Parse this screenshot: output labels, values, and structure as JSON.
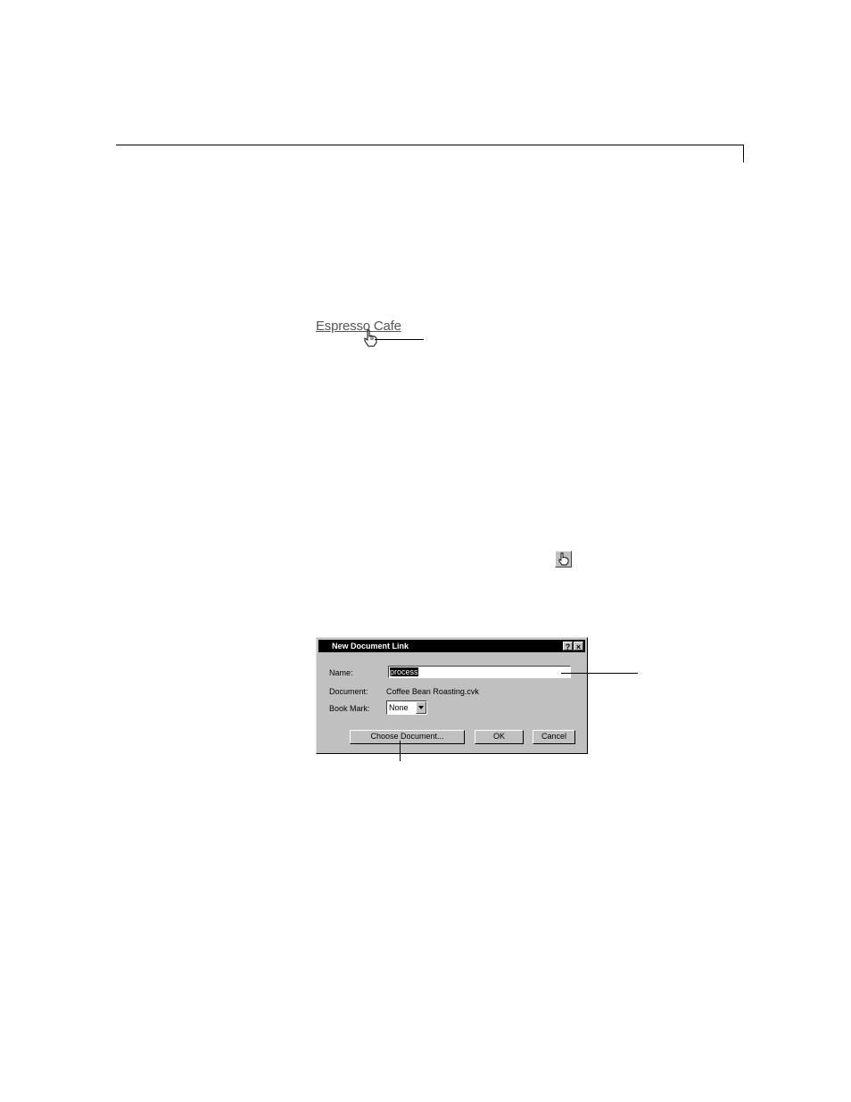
{
  "page": {
    "hyperlink_text": "Espresso Cafe"
  },
  "dialog": {
    "title": "New Document Link",
    "help_button": "?",
    "close_button": "×",
    "name_label": "Name:",
    "name_value": "process",
    "document_label": "Document:",
    "document_value": "Coffee Bean Roasting.cvk",
    "bookmark_label": "Book Mark:",
    "bookmark_value": "None",
    "choose_document_button": "Choose Document...",
    "ok_button": "OK",
    "cancel_button": "Cancel"
  },
  "icons": {
    "hand_cursor": "hand-pointer-icon",
    "toolbar_link_tool": "hand-pointer-icon"
  }
}
